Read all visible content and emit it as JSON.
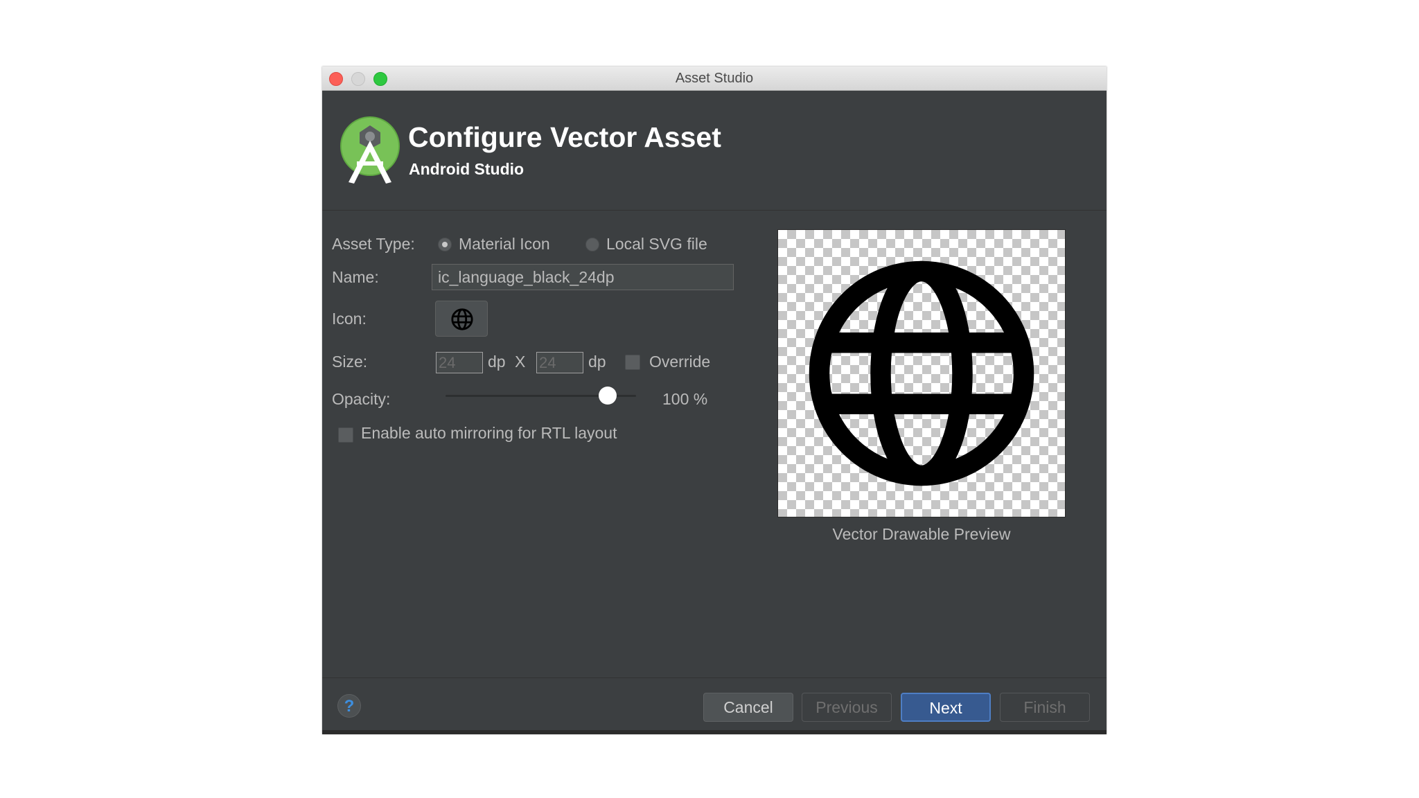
{
  "window": {
    "title": "Asset Studio"
  },
  "header": {
    "title": "Configure Vector Asset",
    "subtitle": "Android Studio"
  },
  "form": {
    "asset_type_label": "Asset Type:",
    "asset_type_options": [
      {
        "label": "Material Icon",
        "selected": true
      },
      {
        "label": "Local SVG file",
        "selected": false
      }
    ],
    "name_label": "Name:",
    "name_value": "ic_language_black_24dp",
    "icon_label": "Icon:",
    "icon_name": "globe-icon",
    "size_label": "Size:",
    "width_value": "24",
    "height_value": "24",
    "unit": "dp",
    "times": "X",
    "override_label": "Override",
    "override_checked": false,
    "opacity_label": "Opacity:",
    "opacity_percent": 100,
    "opacity_text": "100 %",
    "auto_mirror_label": "Enable auto mirroring for RTL layout",
    "auto_mirror_checked": false
  },
  "preview": {
    "caption": "Vector Drawable Preview",
    "icon_name": "globe-icon"
  },
  "footer": {
    "help_label": "?",
    "cancel_label": "Cancel",
    "previous_label": "Previous",
    "next_label": "Next",
    "finish_label": "Finish"
  },
  "colors": {
    "window_bg": "#3c3f41",
    "accent": "#375a90",
    "android_green": "#a4c639"
  }
}
